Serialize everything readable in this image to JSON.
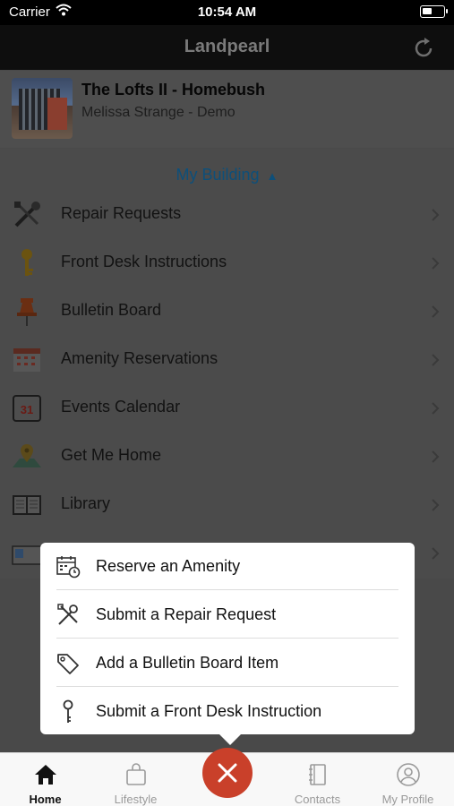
{
  "status_bar": {
    "carrier": "Carrier",
    "time": "10:54 AM"
  },
  "nav": {
    "title": "Landpearl"
  },
  "property": {
    "name": "The Lofts II - Homebush",
    "user": "Melissa Strange - Demo"
  },
  "section": {
    "label": "My Building",
    "arrow": "▲"
  },
  "menu": [
    {
      "label": "Repair Requests",
      "icon": "wrench-screwdriver-icon"
    },
    {
      "label": "Front Desk Instructions",
      "icon": "key-icon"
    },
    {
      "label": "Bulletin Board",
      "icon": "pushpin-icon"
    },
    {
      "label": "Amenity Reservations",
      "icon": "calendar-grid-icon"
    },
    {
      "label": "Events Calendar",
      "icon": "calendar-31-icon"
    },
    {
      "label": "Get Me Home",
      "icon": "map-pin-icon"
    },
    {
      "label": "Library",
      "icon": "book-icon"
    }
  ],
  "popup": [
    {
      "label": "Reserve an Amenity",
      "icon": "calendar-clock-icon"
    },
    {
      "label": "Submit a Repair Request",
      "icon": "tools-icon"
    },
    {
      "label": "Add a Bulletin Board Item",
      "icon": "tag-icon"
    },
    {
      "label": "Submit a Front Desk Instruction",
      "icon": "key-icon"
    }
  ],
  "tabs": [
    {
      "label": "Home",
      "icon": "home-icon",
      "active": true
    },
    {
      "label": "Lifestyle",
      "icon": "shopping-bag-icon"
    },
    {
      "label": "Contacts",
      "icon": "address-book-icon"
    },
    {
      "label": "My Profile",
      "icon": "profile-icon"
    }
  ],
  "colors": {
    "accent": "#c9402a",
    "section_link": "#0d4f7a"
  }
}
